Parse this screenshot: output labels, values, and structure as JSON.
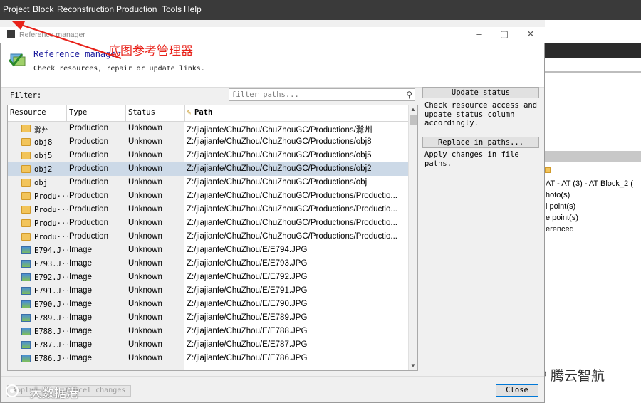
{
  "menubar": {
    "items": [
      "Project",
      "Block",
      "Reconstruction",
      "Production",
      "Tools",
      "Help"
    ]
  },
  "dialog": {
    "window_title": "Reference manager",
    "heading": "Reference manager",
    "subtitle": "Check resources, repair or update links.",
    "annotation": "底图参考管理器",
    "filter_label": "Filter:",
    "filter_placeholder": "filter paths...",
    "columns": [
      "Resource",
      "Type",
      "Status",
      "Path"
    ],
    "rows": [
      {
        "icon": "folder-icon",
        "resource": "滁州",
        "type": "Production",
        "status": "Unknown",
        "path": "Z:/jiajianfe/ChuZhou/ChuZhouGC/Productions/滁州"
      },
      {
        "icon": "folder-icon",
        "resource": "obj8",
        "type": "Production",
        "status": "Unknown",
        "path": "Z:/jiajianfe/ChuZhou/ChuZhouGC/Productions/obj8"
      },
      {
        "icon": "folder-icon",
        "resource": "obj5",
        "type": "Production",
        "status": "Unknown",
        "path": "Z:/jiajianfe/ChuZhou/ChuZhouGC/Productions/obj5"
      },
      {
        "icon": "folder-icon",
        "resource": "obj2",
        "type": "Production",
        "status": "Unknown",
        "path": "Z:/jiajianfe/ChuZhou/ChuZhouGC/Productions/obj2",
        "selected": true
      },
      {
        "icon": "folder-icon",
        "resource": "obj",
        "type": "Production",
        "status": "Unknown",
        "path": "Z:/jiajianfe/ChuZhou/ChuZhouGC/Productions/obj"
      },
      {
        "icon": "folder-icon",
        "resource": "Produ···",
        "type": "Production",
        "status": "Unknown",
        "path": "Z:/jiajianfe/ChuZhou/ChuZhouGC/Productions/Productio..."
      },
      {
        "icon": "folder-icon",
        "resource": "Produ···",
        "type": "Production",
        "status": "Unknown",
        "path": "Z:/jiajianfe/ChuZhou/ChuZhouGC/Productions/Productio..."
      },
      {
        "icon": "folder-icon",
        "resource": "Produ···",
        "type": "Production",
        "status": "Unknown",
        "path": "Z:/jiajianfe/ChuZhou/ChuZhouGC/Productions/Productio..."
      },
      {
        "icon": "folder-icon",
        "resource": "Produ···",
        "type": "Production",
        "status": "Unknown",
        "path": "Z:/jiajianfe/ChuZhou/ChuZhouGC/Productions/Productio..."
      },
      {
        "icon": "image-icon",
        "resource": "E794.J···",
        "type": "Image",
        "status": "Unknown",
        "path": "Z:/jiajianfe/ChuZhou/E/E794.JPG"
      },
      {
        "icon": "image-icon",
        "resource": "E793.J···",
        "type": "Image",
        "status": "Unknown",
        "path": "Z:/jiajianfe/ChuZhou/E/E793.JPG"
      },
      {
        "icon": "image-icon",
        "resource": "E792.J···",
        "type": "Image",
        "status": "Unknown",
        "path": "Z:/jiajianfe/ChuZhou/E/E792.JPG"
      },
      {
        "icon": "image-icon",
        "resource": "E791.J···",
        "type": "Image",
        "status": "Unknown",
        "path": "Z:/jiajianfe/ChuZhou/E/E791.JPG"
      },
      {
        "icon": "image-icon",
        "resource": "E790.J···",
        "type": "Image",
        "status": "Unknown",
        "path": "Z:/jiajianfe/ChuZhou/E/E790.JPG"
      },
      {
        "icon": "image-icon",
        "resource": "E789.J···",
        "type": "Image",
        "status": "Unknown",
        "path": "Z:/jiajianfe/ChuZhou/E/E789.JPG"
      },
      {
        "icon": "image-icon",
        "resource": "E788.J···",
        "type": "Image",
        "status": "Unknown",
        "path": "Z:/jiajianfe/ChuZhou/E/E788.JPG"
      },
      {
        "icon": "image-icon",
        "resource": "E787.J···",
        "type": "Image",
        "status": "Unknown",
        "path": "Z:/jiajianfe/ChuZhou/E/E787.JPG"
      },
      {
        "icon": "image-icon",
        "resource": "E786.J···",
        "type": "Image",
        "status": "Unknown",
        "path": "Z:/jiajianfe/ChuZhou/E/E786.JPG"
      }
    ],
    "side_panel": {
      "update_status_label": "Update status",
      "update_status_desc": "Check resource access and update status column accordingly.",
      "replace_label": "Replace in paths...",
      "replace_desc": "Apply changes in file paths."
    },
    "footer": {
      "apply_label": "Apply",
      "cancel_changes_label": "Cancel changes",
      "close_label": "Close"
    }
  },
  "background_app": {
    "tree": [
      "AT - AT (3) - AT Block_2 (",
      "hoto(s)",
      "l point(s)",
      "e point(s)",
      "erenced"
    ]
  },
  "watermarks": {
    "left": "大数据港",
    "right": "腾云智航"
  },
  "colors": {
    "menubar_bg": "#3a3a3a",
    "annotation_red": "#e8221a",
    "heading_blue": "#1a1a9c",
    "selected_row": "#ccd9e7"
  }
}
